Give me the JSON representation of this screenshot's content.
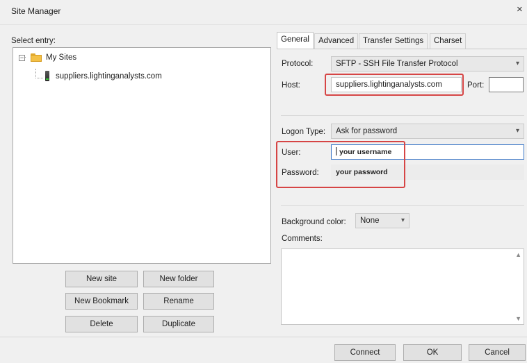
{
  "window": {
    "title": "Site Manager",
    "close_glyph": "×"
  },
  "tree": {
    "select_label": "Select entry:",
    "root": {
      "label": "My Sites",
      "expander": "−"
    },
    "site": {
      "label": "suppliers.lightinganalysts.com"
    }
  },
  "left_buttons": {
    "new_site": "New site",
    "new_folder": "New folder",
    "new_bookmark": "New Bookmark",
    "rename": "Rename",
    "delete": "Delete",
    "duplicate": "Duplicate"
  },
  "tabs": [
    "General",
    "Advanced",
    "Transfer Settings",
    "Charset"
  ],
  "general": {
    "protocol_label": "Protocol:",
    "protocol_value": "SFTP - SSH File Transfer Protocol",
    "host_label": "Host:",
    "host_value": "suppliers.lightinganalysts.com",
    "port_label": "Port:",
    "port_value": "",
    "logon_type_label": "Logon Type:",
    "logon_type_value": "Ask for password",
    "user_label": "User:",
    "user_value": "your username",
    "password_label": "Password:",
    "password_value": "your password",
    "bg_color_label": "Background color:",
    "bg_color_value": "None",
    "comments_label": "Comments:"
  },
  "footer": {
    "connect": "Connect",
    "ok": "OK",
    "cancel": "Cancel"
  },
  "colors": {
    "highlight_box": "#d64545",
    "folder": "#f4c146"
  },
  "icons": {
    "dropdown": "▾",
    "scroll_up": "▲",
    "scroll_down": "▼"
  }
}
